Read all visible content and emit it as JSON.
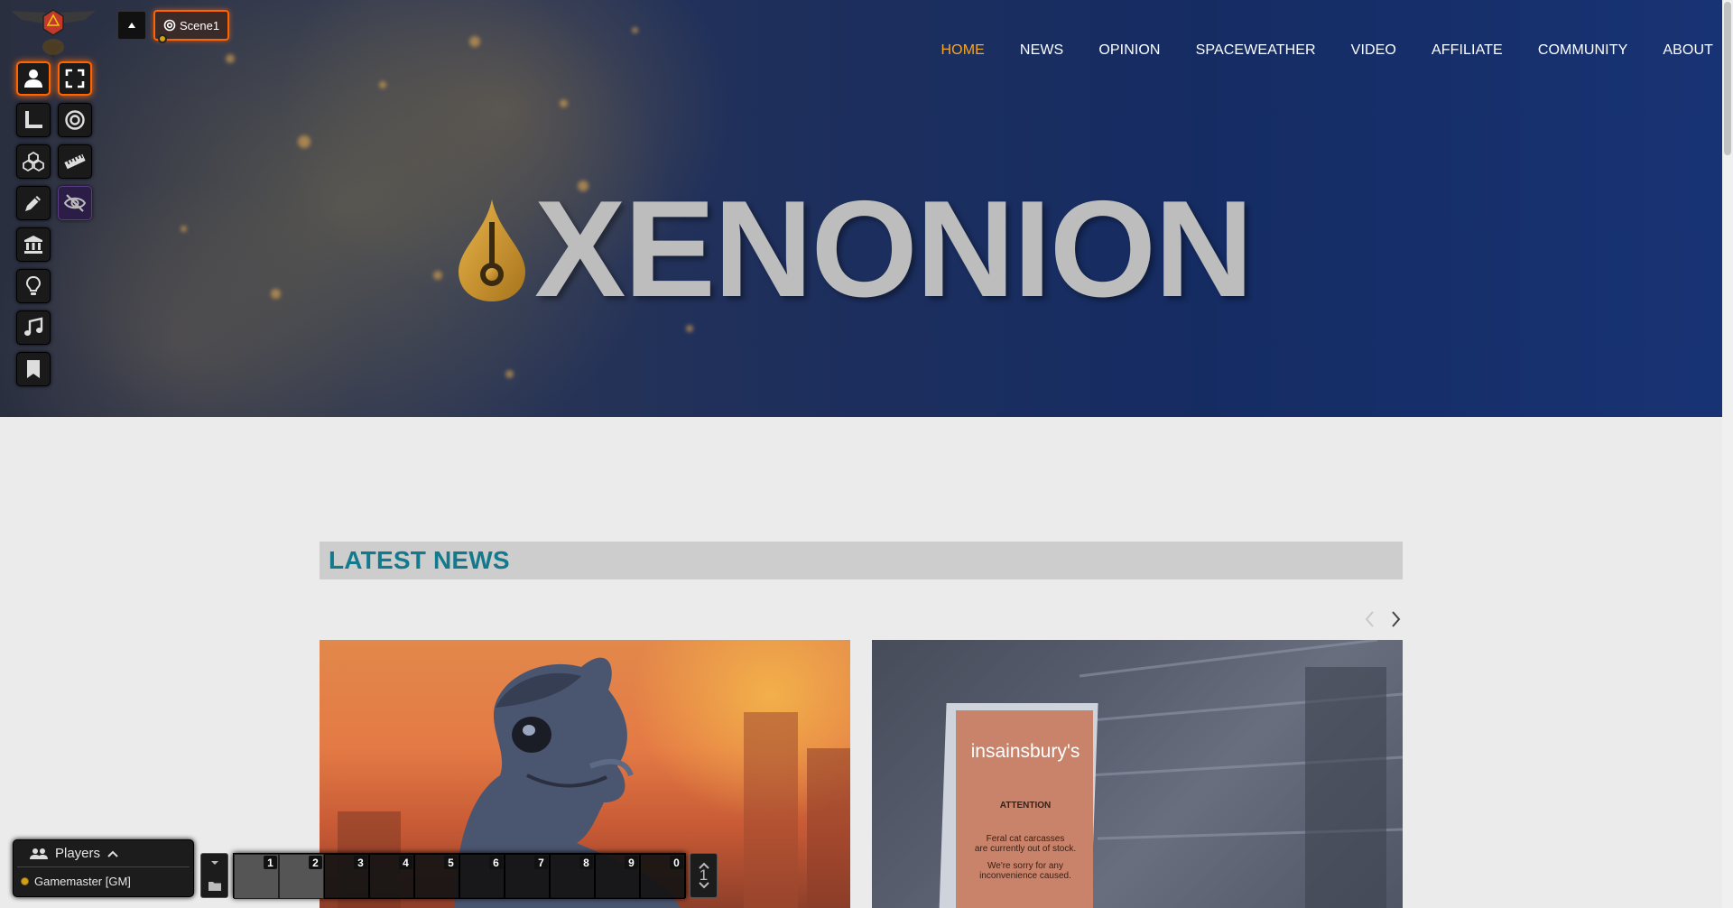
{
  "site": {
    "logo_text": "XENONION",
    "nav": [
      {
        "label": "HOME",
        "active": true
      },
      {
        "label": "NEWS",
        "active": false
      },
      {
        "label": "OPINION",
        "active": false
      },
      {
        "label": "SPACEWEATHER",
        "active": false
      },
      {
        "label": "VIDEO",
        "active": false
      },
      {
        "label": "AFFILIATE",
        "active": false
      },
      {
        "label": "COMMUNITY",
        "active": false
      },
      {
        "label": "ABOUT",
        "active": false
      }
    ],
    "nav_active_color": "#f5a623",
    "latest_news_title": "LATEST NEWS",
    "accent_color": "#127a8c",
    "cards": [
      {
        "image": "lizard-alien-portrait"
      },
      {
        "image": "empty-shelves-sign",
        "sign_brand": "insainsbury's",
        "sign_heading": "ATTENTION",
        "sign_line1": "Feral cat carcasses",
        "sign_line2": "are currently out of stock.",
        "sign_line3": "We're sorry for any",
        "sign_line4": "inconvenience caused."
      }
    ]
  },
  "vtt": {
    "scene_tab_label": "Scene1",
    "controls": [
      {
        "icon": "token-user-icon",
        "active": true
      },
      {
        "icon": "fullscreen-icon",
        "active": true
      },
      {
        "icon": "ruler-measure-icon"
      },
      {
        "icon": "target-icon"
      },
      {
        "icon": "tiles-cubes-icon"
      },
      {
        "icon": "ruler-icon"
      },
      {
        "icon": "pencil-draw-icon"
      },
      {
        "icon": "eye-slash-icon",
        "toggled": true
      },
      {
        "icon": "landmark-icon"
      },
      {
        "icon": "lightbulb-icon"
      },
      {
        "icon": "music-icon"
      },
      {
        "icon": "bookmark-icon"
      }
    ],
    "players": {
      "title": "Players",
      "entries": [
        {
          "name": "Gamemaster [GM]",
          "color": "#d4a017"
        }
      ]
    },
    "hotbar": {
      "keys": [
        "1",
        "2",
        "3",
        "4",
        "5",
        "6",
        "7",
        "8",
        "9",
        "0"
      ],
      "page": "1"
    }
  }
}
